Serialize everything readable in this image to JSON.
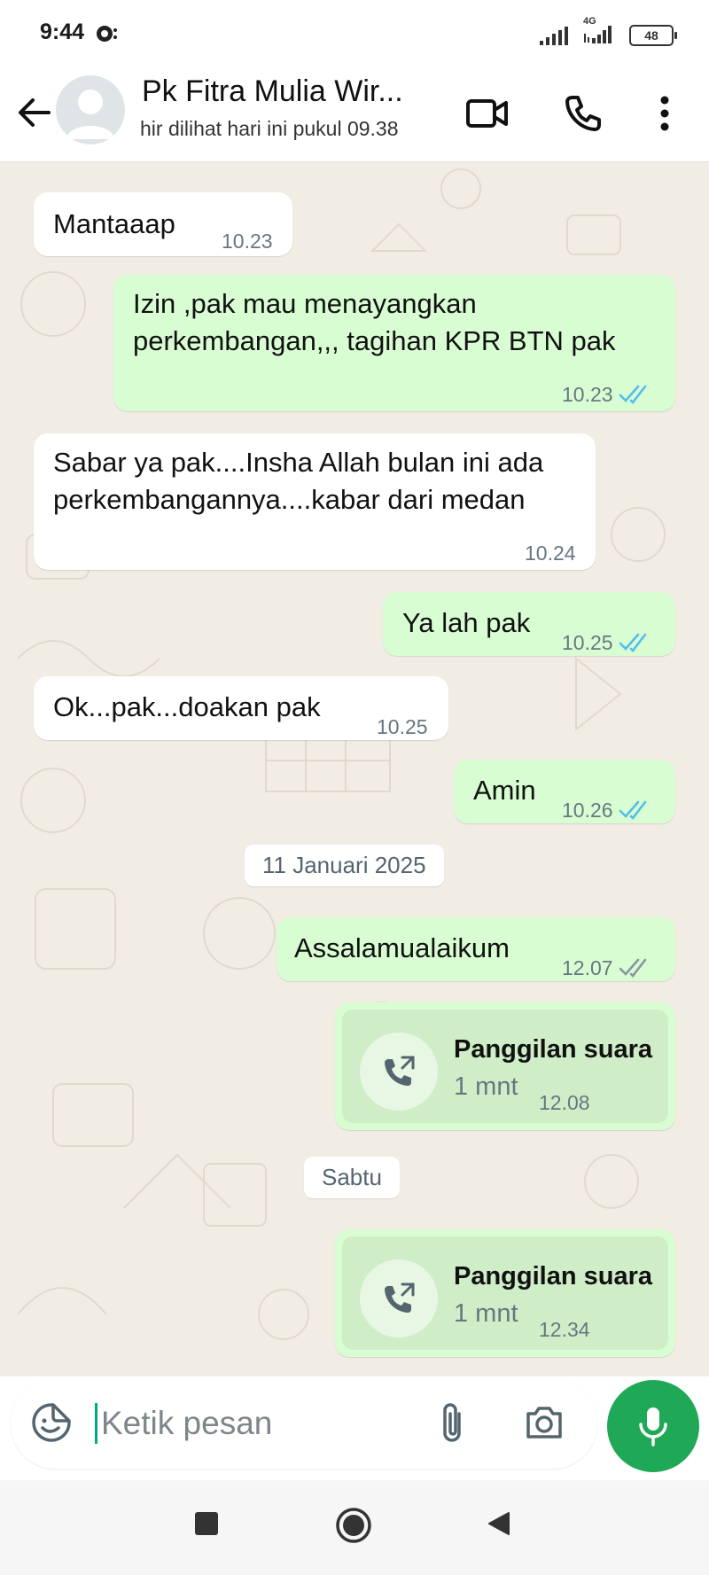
{
  "status_bar": {
    "time": "9:44",
    "network_label": "4G",
    "battery": "48"
  },
  "header": {
    "contact_name": "Pk Fitra Mulia Wir...",
    "contact_status": "hir dilihat hari ini pukul 09.38"
  },
  "messages": [
    {
      "dir": "in",
      "text": "Mantaaap",
      "time": "10.23"
    },
    {
      "dir": "out",
      "text": "Izin ,pak mau menayangkan perkembangan,,, tagihan KPR BTN pak",
      "time": "10.23",
      "status": "read"
    },
    {
      "dir": "in",
      "text": "Sabar ya pak....Insha Allah bulan ini ada perkembangannya....kabar dari medan",
      "time": "10.24"
    },
    {
      "dir": "out",
      "text": "Ya lah pak",
      "time": "10.25",
      "status": "read"
    },
    {
      "dir": "in",
      "text": "Ok...pak...doakan pak",
      "time": "10.25"
    },
    {
      "dir": "out",
      "text": "Amin",
      "time": "10.26",
      "status": "read"
    },
    {
      "dir": "out",
      "text": "Assalamualaikum",
      "time": "12.07",
      "status": "delivered"
    }
  ],
  "date_chips": [
    "11 Januari 2025",
    "Sabtu"
  ],
  "calls": [
    {
      "title": "Panggilan suara",
      "duration": "1 mnt",
      "time": "12.08"
    },
    {
      "title": "Panggilan suara",
      "duration": "1 mnt",
      "time": "12.34"
    }
  ],
  "composer": {
    "placeholder": "Ketik pesan"
  },
  "colors": {
    "outgoing": "#d9fdd3",
    "incoming": "#ffffff",
    "wallpaper": "#f2ede4",
    "read_tick": "#53bdeb",
    "accent": "#1fa855"
  },
  "icons": [
    "back-arrow-icon",
    "video-call-icon",
    "phone-icon",
    "more-menu-icon",
    "sticker-icon",
    "attach-icon",
    "camera-icon",
    "mic-icon",
    "outgoing-call-icon",
    "stop-icon",
    "home-icon",
    "back-triangle-icon"
  ]
}
